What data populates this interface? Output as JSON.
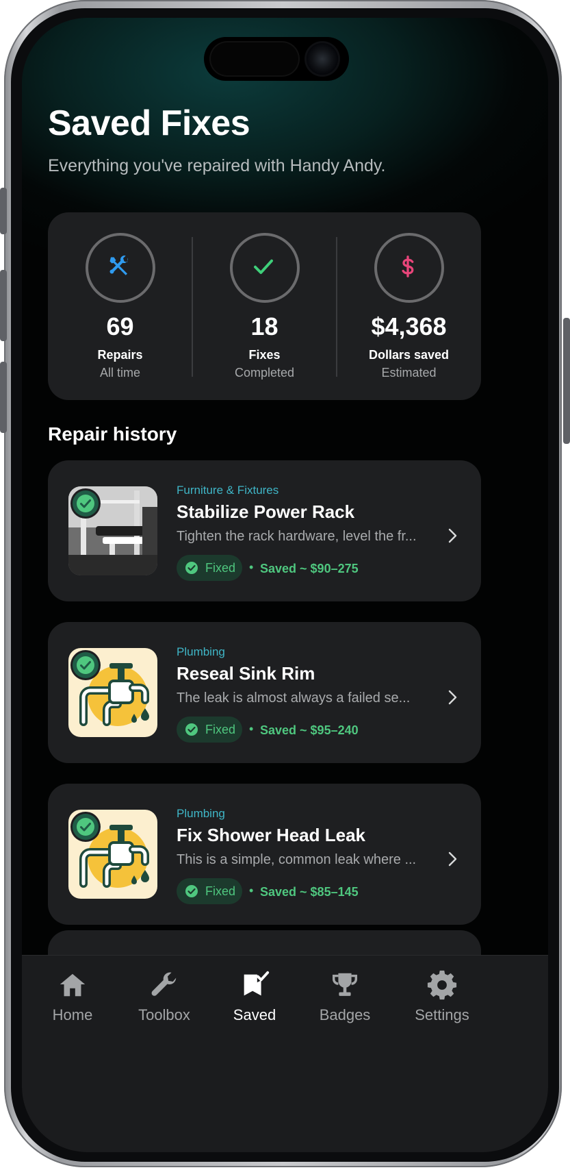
{
  "page": {
    "title": "Saved Fixes",
    "subtitle": "Everything you've repaired with Handy Andy."
  },
  "stats": [
    {
      "icon": "wrench-screwdriver-icon",
      "value": "69",
      "label": "Repairs",
      "sublabel": "All time",
      "color": "#2f9bf0"
    },
    {
      "icon": "check-icon",
      "value": "18",
      "label": "Fixes",
      "sublabel": "Completed",
      "color": "#3fcf7a"
    },
    {
      "icon": "dollar-icon",
      "value": "$4,368",
      "label": "Dollars saved",
      "sublabel": "Estimated",
      "color": "#e8457a"
    }
  ],
  "section_title": "Repair history",
  "repairs": [
    {
      "category": "Furniture & Fixtures",
      "title": "Stabilize Power Rack",
      "description": "Tighten the rack hardware, level the fr...",
      "status": "Fixed",
      "saved": "Saved ~ $90–275",
      "thumb": "power-rack-photo"
    },
    {
      "category": "Plumbing",
      "title": "Reseal Sink Rim",
      "description": "The leak is almost always a failed se...",
      "status": "Fixed",
      "saved": "Saved ~ $95–240",
      "thumb": "faucet-icon"
    },
    {
      "category": "Plumbing",
      "title": "Fix Shower Head Leak",
      "description": "This is a simple, common leak where ...",
      "status": "Fixed",
      "saved": "Saved ~ $85–145",
      "thumb": "faucet-icon"
    }
  ],
  "tabs": [
    {
      "label": "Home",
      "icon": "home-icon",
      "active": false
    },
    {
      "label": "Toolbox",
      "icon": "wrench-icon",
      "active": false
    },
    {
      "label": "Saved",
      "icon": "saved-flag-icon",
      "active": true
    },
    {
      "label": "Badges",
      "icon": "trophy-icon",
      "active": false
    },
    {
      "label": "Settings",
      "icon": "gear-icon",
      "active": false
    }
  ],
  "colors": {
    "accent_teal": "#3fb6c7",
    "success_green": "#4fc77f",
    "card_bg": "#1e1f21"
  }
}
